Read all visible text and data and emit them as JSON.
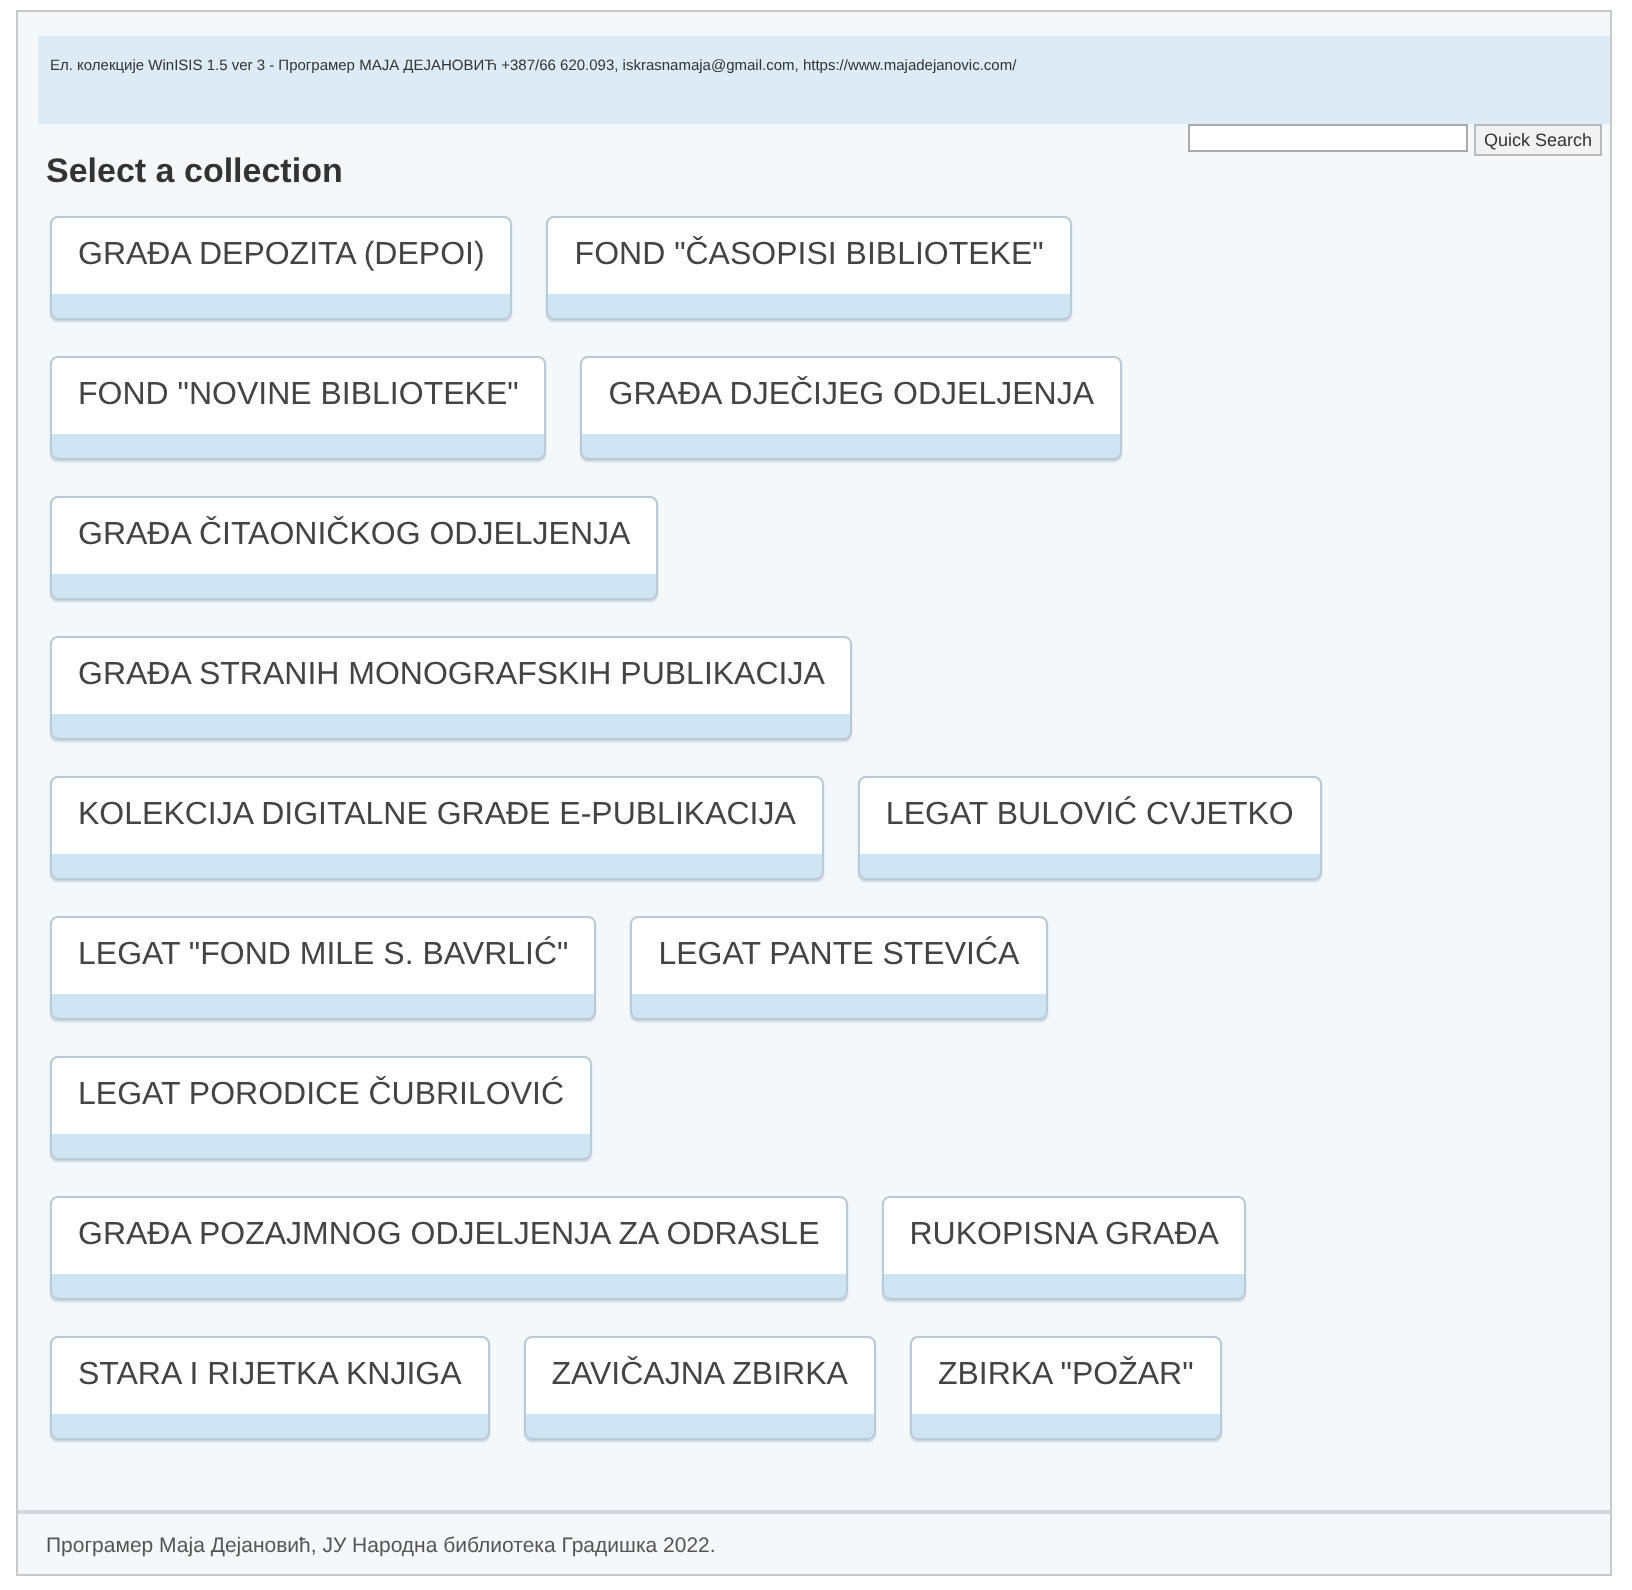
{
  "header": {
    "text": "Ел. колекције WinISIS 1.5 ver 3 - Програмер МАЈА ДЕЈАНОВИЋ +387/66 620.093, iskrasnamaja@gmail.com, https://www.majadejanovic.com/"
  },
  "search": {
    "button": "Quick Search"
  },
  "title": "Select a collection",
  "rows": [
    [
      "GRAĐA DEPOZITA (DEPOI)",
      "FOND \"ČASOPISI BIBLIOTEKE\""
    ],
    [
      "FOND \"NOVINE BIBLIOTEKE\"",
      "GRAĐA DJEČIJEG ODJELJENJA"
    ],
    [
      "GRAĐA ČITAONIČKOG ODJELJENJA"
    ],
    [
      "GRAĐA STRANIH MONOGRAFSKIH PUBLIKACIJA"
    ],
    [
      "KOLEKCIJA DIGITALNE GRAĐE E-PUBLIKACIJA",
      "LEGAT BULOVIĆ CVJETKO"
    ],
    [
      "LEGAT \"FOND MILE S. BAVRLIĆ\"",
      "LEGAT PANTE STEVIĆA"
    ],
    [
      "LEGAT PORODICE ČUBRILOVIĆ"
    ],
    [
      "GRAĐA POZAJMNOG ODJELJENJA ZA ODRASLE",
      "RUKOPISNA GRAĐA"
    ],
    [
      "STARA I RIJETKA KNJIGA",
      "ZAVIČAJNA ZBIRKA",
      "ZBIRKA \"POŽAR\""
    ]
  ],
  "footer": "Програмер Маја Дејановић, ЈУ Народна библиотека Градишка 2022."
}
